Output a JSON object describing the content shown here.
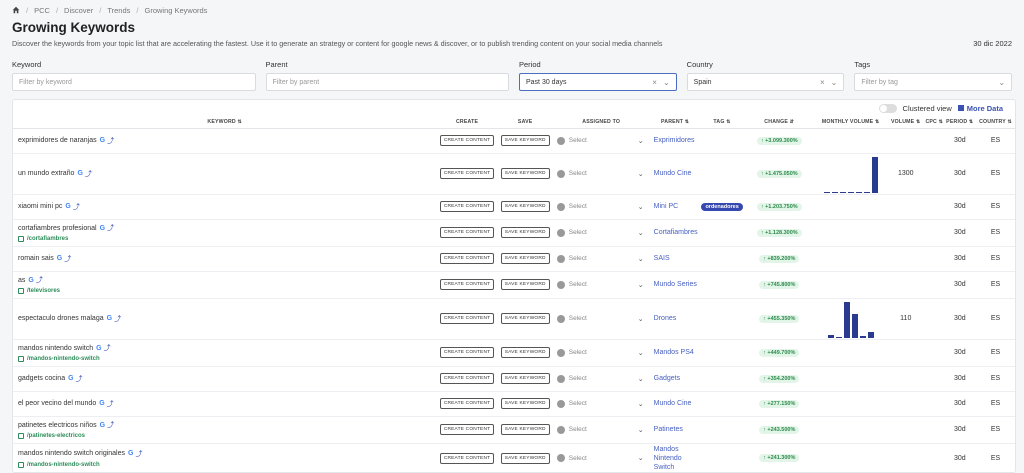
{
  "breadcrumb": [
    "PCC",
    "Discover",
    "Trends",
    "Growing Keywords"
  ],
  "page": {
    "title": "Growing Keywords",
    "subtitle": "Discover the keywords from your topic list that are accelerating the fastest. Use it to generate an strategy or content for google news & discover, or to publish trending content on your social media channels",
    "date": "30 dic 2022"
  },
  "filters": {
    "keyword": {
      "label": "Keyword",
      "placeholder": "Filter by keyword"
    },
    "parent": {
      "label": "Parent",
      "placeholder": "Filter by parent"
    },
    "period": {
      "label": "Period",
      "value": "Past 30 days"
    },
    "country": {
      "label": "Country",
      "value": "Spain"
    },
    "tags": {
      "label": "Tags",
      "placeholder": "Filter by tag"
    }
  },
  "toolbar": {
    "clustered_label": "Clustered view",
    "more_data_label": "More Data"
  },
  "columns": {
    "keyword": "KEYWORD ⇅",
    "create": "CREATE",
    "save": "SAVE",
    "assigned": "ASSIGNED TO",
    "parent": "PARENT ⇅",
    "tag": "TAG ⇅",
    "change": "CHANGE ⇵",
    "monthly": "MONTHLY VOLUME ⇅",
    "volume": "VOLUME ⇅",
    "cpc": "CPC ⇅",
    "period": "PERIOD ⇅",
    "country": "COUNTRY ⇅"
  },
  "labels": {
    "create_btn": "CREATE CONTENT",
    "save_btn": "SAVE KEYWORD",
    "select": "Select"
  },
  "rows": [
    {
      "keyword": "exprimidores de naranjas",
      "slug": "",
      "parent": "Exprimidores",
      "tag": "",
      "change": "↑ +3.099.300%",
      "spark": [],
      "volume": "",
      "period": "30d",
      "country": "ES"
    },
    {
      "keyword": "un mundo extraño",
      "slug": "",
      "parent": "Mundo Cine",
      "tag": "",
      "change": "↑ +1.475.050%",
      "spark": [
        1,
        1,
        1,
        1,
        2,
        3,
        100
      ],
      "volume": "1300",
      "period": "30d",
      "country": "ES"
    },
    {
      "keyword": "xiaomi mini pc",
      "slug": "",
      "parent": "Mini PC",
      "tag": "ordenadores",
      "change": "↑ +1.203.750%",
      "spark": [],
      "volume": "",
      "period": "30d",
      "country": "ES"
    },
    {
      "keyword": "cortafiambres profesional",
      "slug": "/cortafiambres",
      "parent": "Cortafiambres",
      "tag": "",
      "change": "↑ +1.128.300%",
      "spark": [],
      "volume": "",
      "period": "30d",
      "country": "ES"
    },
    {
      "keyword": "romain sais",
      "slug": "",
      "parent": "SAIS",
      "tag": "",
      "change": "↑ +839.200%",
      "spark": [],
      "volume": "",
      "period": "30d",
      "country": "ES"
    },
    {
      "keyword": "as",
      "slug": "/televisores",
      "parent": "Mundo Series",
      "tag": "",
      "change": "↑ +745.800%",
      "spark": [],
      "volume": "",
      "period": "30d",
      "country": "ES"
    },
    {
      "keyword": "espectaculo drones malaga",
      "slug": "",
      "parent": "Drones",
      "tag": "",
      "change": "↑ +455.350%",
      "spark": [
        8,
        2,
        100,
        68,
        5,
        18
      ],
      "volume": "110",
      "period": "30d",
      "country": "ES"
    },
    {
      "keyword": "mandos nintendo switch",
      "slug": "/mandos-nintendo-switch",
      "parent": "Mandos PS4",
      "tag": "",
      "change": "↑ +449.700%",
      "spark": [],
      "volume": "",
      "period": "30d",
      "country": "ES"
    },
    {
      "keyword": "gadgets cocina",
      "slug": "",
      "parent": "Gadgets",
      "tag": "",
      "change": "↑ +354.200%",
      "spark": [],
      "volume": "",
      "period": "30d",
      "country": "ES"
    },
    {
      "keyword": "el peor vecino del mundo",
      "slug": "",
      "parent": "Mundo Cine",
      "tag": "",
      "change": "↑ +277.150%",
      "spark": [],
      "volume": "",
      "period": "30d",
      "country": "ES"
    },
    {
      "keyword": "patinetes electricos niños",
      "slug": "/patinetes-electricos",
      "parent": "Patinetes",
      "tag": "",
      "change": "↑ +243.500%",
      "spark": [],
      "volume": "",
      "period": "30d",
      "country": "ES"
    },
    {
      "keyword": "mandos nintendo switch originales",
      "slug": "/mandos-nintendo-switch",
      "parent": "Mandos Nintendo Switch",
      "tag": "",
      "change": "↑ +241.300%",
      "spark": [],
      "volume": "",
      "period": "30d",
      "country": "ES"
    }
  ]
}
